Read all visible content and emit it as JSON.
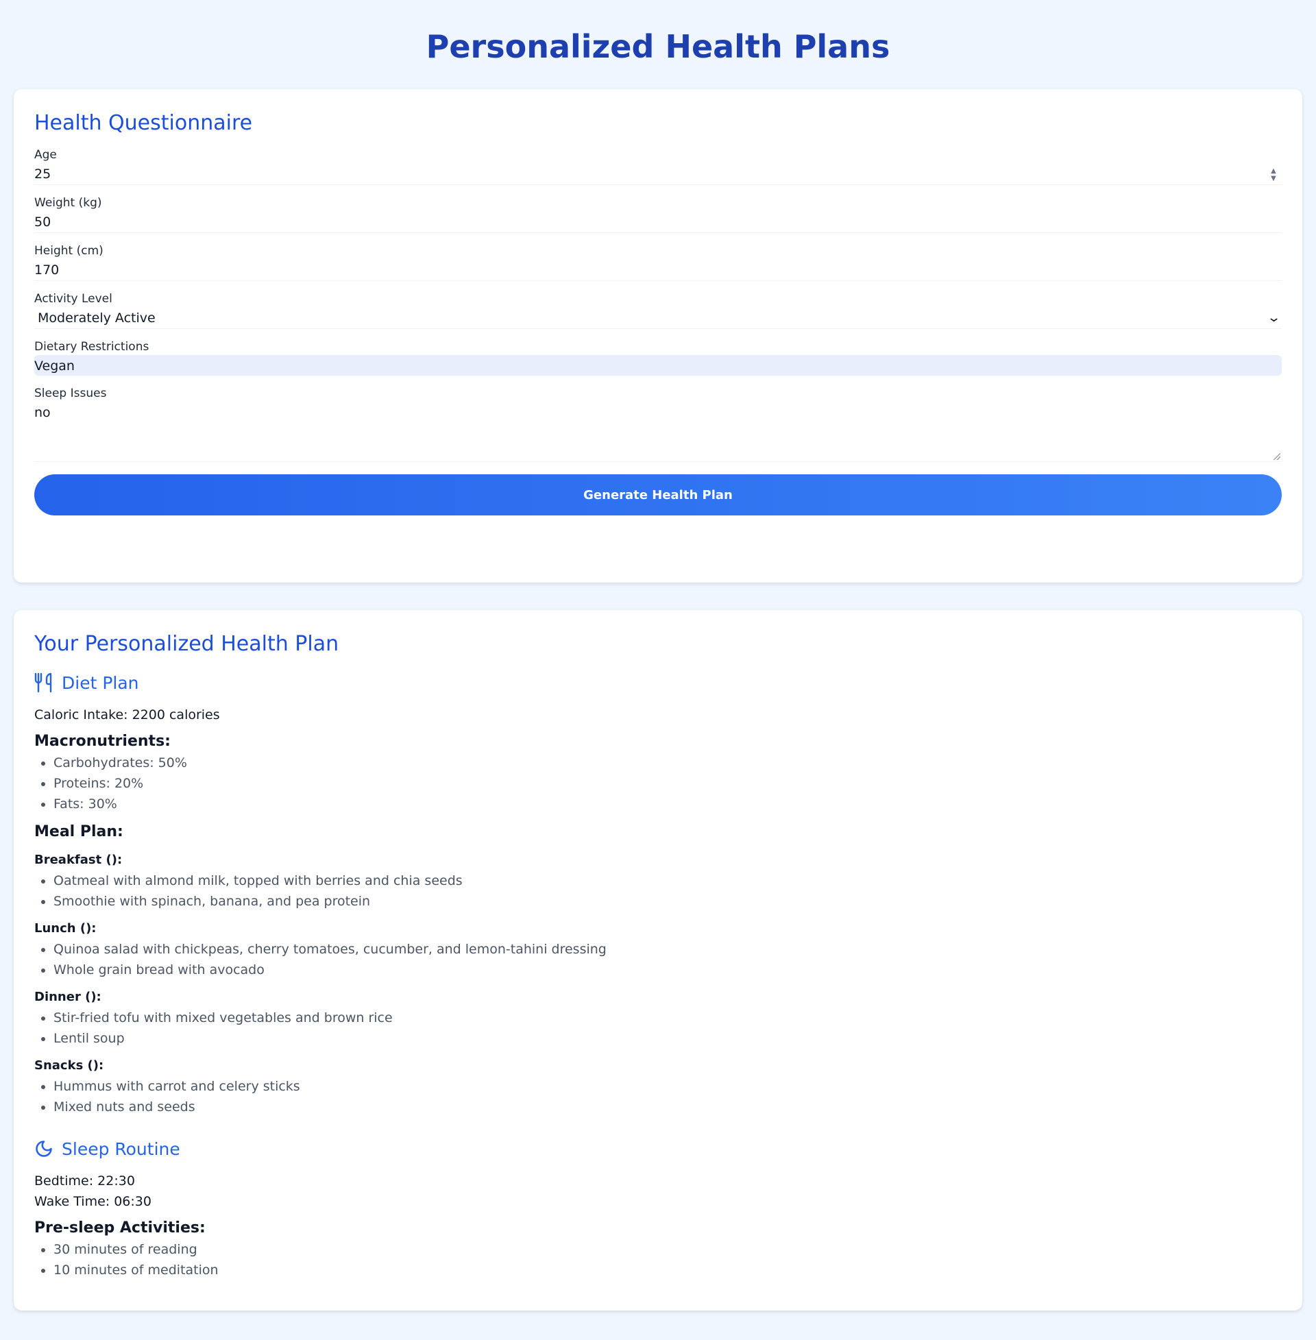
{
  "page": {
    "title": "Personalized Health Plans"
  },
  "questionnaire": {
    "title": "Health Questionnaire",
    "age": {
      "label": "Age",
      "value": "25"
    },
    "weight": {
      "label": "Weight (kg)",
      "value": "50"
    },
    "height": {
      "label": "Height (cm)",
      "value": "170"
    },
    "activity": {
      "label": "Activity Level",
      "value": "Moderately Active"
    },
    "dietary": {
      "label": "Dietary Restrictions",
      "value": "Vegan"
    },
    "sleep_issues": {
      "label": "Sleep Issues",
      "value": "no"
    },
    "generate_label": "Generate Health Plan"
  },
  "plan": {
    "title": "Your Personalized Health Plan",
    "diet": {
      "title": "Diet Plan",
      "icon": "utensils-icon",
      "caloric_intake": "Caloric Intake: 2200 calories",
      "macros_title": "Macronutrients:",
      "macros": [
        "Carbohydrates: 50%",
        "Proteins: 20%",
        "Fats: 30%"
      ],
      "meal_plan_title": "Meal Plan:",
      "meals": [
        {
          "title": "Breakfast ():",
          "items": [
            "Oatmeal with almond milk, topped with berries and chia seeds",
            "Smoothie with spinach, banana, and pea protein"
          ]
        },
        {
          "title": "Lunch ():",
          "items": [
            "Quinoa salad with chickpeas, cherry tomatoes, cucumber, and lemon-tahini dressing",
            "Whole grain bread with avocado"
          ]
        },
        {
          "title": "Dinner ():",
          "items": [
            "Stir-fried tofu with mixed vegetables and brown rice",
            "Lentil soup"
          ]
        },
        {
          "title": "Snacks ():",
          "items": [
            "Hummus with carrot and celery sticks",
            "Mixed nuts and seeds"
          ]
        }
      ]
    },
    "sleep": {
      "title": "Sleep Routine",
      "icon": "moon-icon",
      "bedtime": "Bedtime: 22:30",
      "wake_time": "Wake Time: 06:30",
      "activities_title": "Pre-sleep Activities:",
      "activities": [
        "30 minutes of reading",
        "10 minutes of meditation"
      ]
    }
  },
  "colors": {
    "background": "#eff6ff",
    "title": "#1e40af",
    "accent": "#2563eb",
    "button_gradient_end": "#3b82f6"
  }
}
